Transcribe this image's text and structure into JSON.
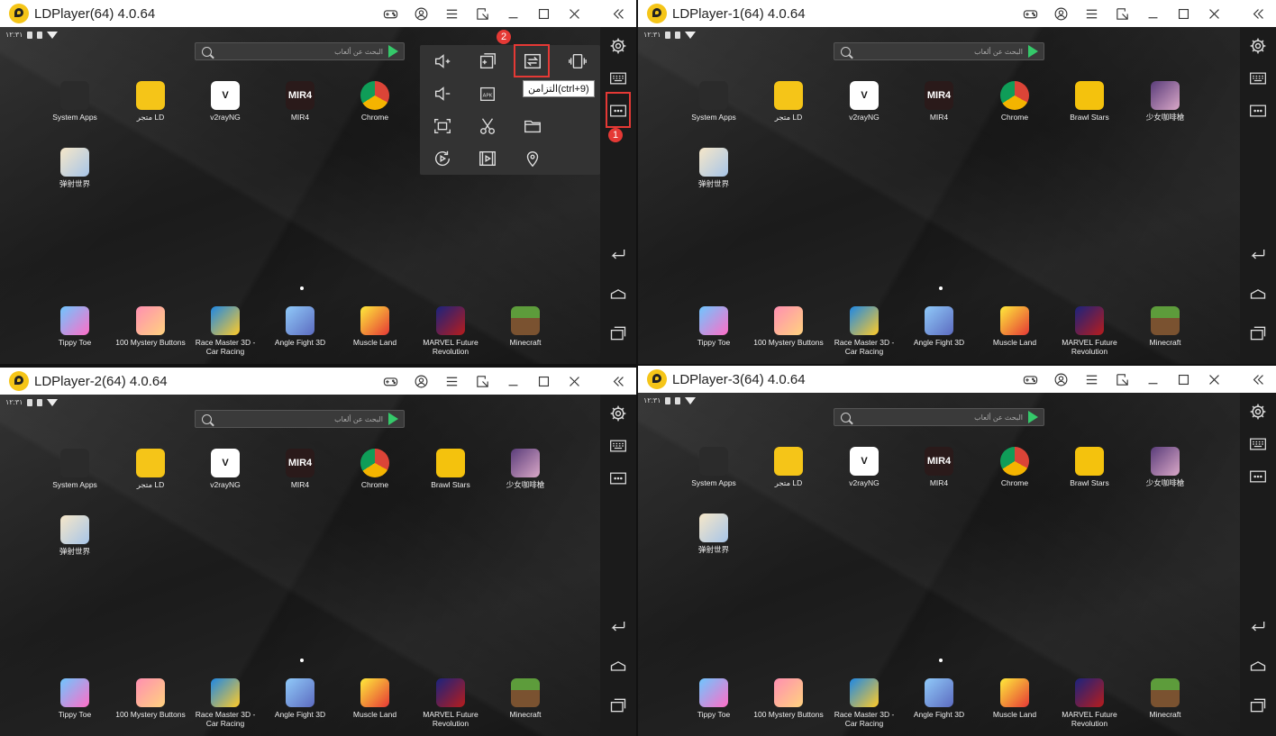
{
  "windows": [
    {
      "title": "LDPlayer(64) 4.0.64",
      "time": "١٢:٣١",
      "search_placeholder": "البحث عن ألعاب",
      "apps": [
        "System Apps",
        "متجر LD",
        "v2rayNG",
        "MIR4",
        "Chrome"
      ],
      "apps_row2": [
        "弹射世界"
      ],
      "dock": [
        "Tippy Toe",
        "100 Mystery Buttons",
        "Race Master 3D - Car Racing",
        "Angle Fight 3D",
        "Muscle Land",
        "MARVEL Future Revolution",
        "Minecraft"
      ]
    },
    {
      "title": "LDPlayer-1(64) 4.0.64",
      "time": "١٢:٣١",
      "search_placeholder": "البحث عن ألعاب",
      "apps": [
        "System Apps",
        "متجر LD",
        "v2rayNG",
        "MIR4",
        "Chrome",
        "Brawl Stars",
        "少女咖啡槍"
      ],
      "apps_row2": [
        "弹射世界"
      ],
      "dock": [
        "Tippy Toe",
        "100 Mystery Buttons",
        "Race Master 3D - Car Racing",
        "Angle Fight 3D",
        "Muscle Land",
        "MARVEL Future Revolution",
        "Minecraft"
      ]
    },
    {
      "title": "LDPlayer-2(64) 4.0.64",
      "time": "١٢:٣١",
      "search_placeholder": "البحث عن ألعاب",
      "apps": [
        "System Apps",
        "متجر LD",
        "v2rayNG",
        "MIR4",
        "Chrome",
        "Brawl Stars",
        "少女咖啡槍"
      ],
      "apps_row2": [
        "弹射世界"
      ],
      "dock": [
        "Tippy Toe",
        "100 Mystery Buttons",
        "Race Master 3D - Car Racing",
        "Angle Fight 3D",
        "Muscle Land",
        "MARVEL Future Revolution",
        "Minecraft"
      ]
    },
    {
      "title": "LDPlayer-3(64) 4.0.64",
      "time": "١٢:٣١",
      "search_placeholder": "البحث عن ألعاب",
      "apps": [
        "System Apps",
        "متجر LD",
        "v2rayNG",
        "MIR4",
        "Chrome",
        "Brawl Stars",
        "少女咖啡槍"
      ],
      "apps_row2": [
        "弹射世界"
      ],
      "dock": [
        "Tippy Toe",
        "100 Mystery Buttons",
        "Race Master 3D - Car Racing",
        "Angle Fight 3D",
        "Muscle Land",
        "MARVEL Future Revolution",
        "Minecraft"
      ]
    }
  ],
  "menu_tooltip": "التزامن(ctrl+9)",
  "badges": {
    "one": "1",
    "two": "2"
  },
  "icon_texts": {
    "mir4": "MIR4",
    "apk": "APK"
  },
  "colors": {
    "highlight": "#e53935",
    "logo": "#f5c518",
    "play": "#35c96a"
  }
}
